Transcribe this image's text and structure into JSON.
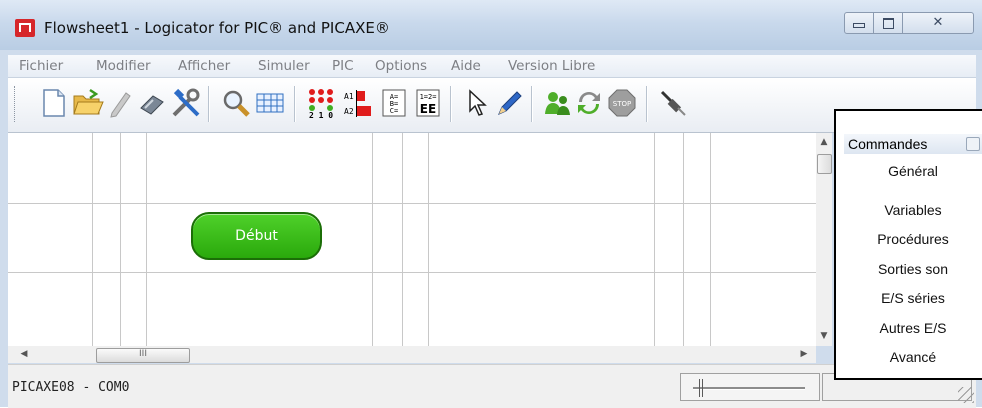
{
  "window": {
    "title": "Flowsheet1 - Logicator for PIC® and PICAXE®",
    "close_glyph": "✕"
  },
  "menu": [
    "Fichier",
    "Modifier",
    "Afficher",
    "Simuler",
    "PIC",
    "Options",
    "Aide",
    "Version Libre"
  ],
  "toolbar": {
    "icons": [
      "new-file-icon",
      "open-folder-icon",
      "pen-icon",
      "connector-icon",
      "tools-icon",
      "zoom-icon",
      "grid-icon",
      "pins-icon",
      "analog-icon",
      "variables-icon",
      "eeprom-icon",
      "pointer-icon",
      "pencil-icon",
      "run-icon",
      "refresh-icon",
      "stop-icon",
      "cable-icon"
    ],
    "pins_label": "2 1 0",
    "analog_labels": [
      "A1",
      "A2"
    ],
    "variables_label": "A= B= C=",
    "eeprom_label": "EE",
    "eeprom_top": "1=2=",
    "stop_label": "STOP"
  },
  "canvas": {
    "start_node": "Début"
  },
  "scrollbar": {
    "up": "▲",
    "down": "▼",
    "left": "◀",
    "right": "▶",
    "thumb_grip": "III"
  },
  "statusbar": {
    "status_text": "PICAXE08 - COM0"
  },
  "commands": {
    "header": "Commandes",
    "items": [
      "Général",
      "Variables",
      "Procédures",
      "Sorties son",
      "E/S séries",
      "Autres E/S",
      "Avancé"
    ]
  },
  "colors": {
    "start_fill": "#2fb512",
    "accent": "#d6262a"
  }
}
